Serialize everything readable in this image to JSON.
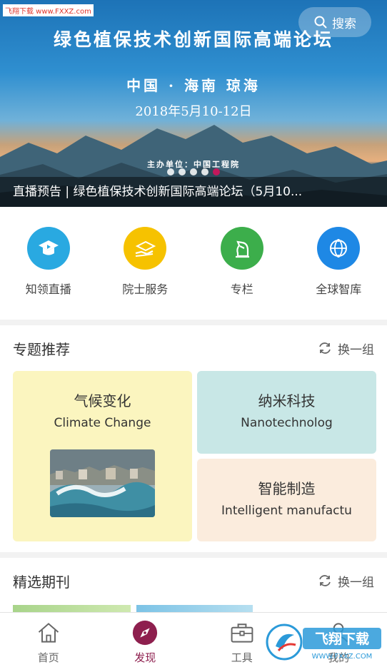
{
  "banner": {
    "watermark": "飞翔下载 www.FXXZ.com",
    "search_label": "搜索",
    "title": "绿色植保技术创新国际高端论坛",
    "location": "中国 · 海南 琼海",
    "date": "2018年5月10-12日",
    "host": "主办单位：中国工程院",
    "caption": "直播预告 | 绿色植保技术创新国际高端论坛（5月10...",
    "dots": 5,
    "active_dot": 4,
    "accent": "#c2185b"
  },
  "quicknav": {
    "items": [
      {
        "label": "知领直播",
        "icon": "graduation-play-icon",
        "color": "#29a9e1"
      },
      {
        "label": "院士服务",
        "icon": "hand-service-icon",
        "color": "#f6c200"
      },
      {
        "label": "专栏",
        "icon": "chess-knight-icon",
        "color": "#3cae4b"
      },
      {
        "label": "全球智库",
        "icon": "globe-network-icon",
        "color": "#1e88e5"
      }
    ]
  },
  "topics": {
    "title": "专题推荐",
    "refresh_label": "换一组",
    "cards": [
      {
        "cn": "气候变化",
        "en": "Climate Change",
        "bg": "#fbf5bf"
      },
      {
        "cn": "纳米科技",
        "en": "Nanotechnolog",
        "bg": "#c8e7e6"
      },
      {
        "cn": "智能制造",
        "en": "Intelligent manufactu",
        "bg": "#fbecdd"
      }
    ]
  },
  "journals": {
    "title": "精选期刊",
    "refresh_label": "换一组"
  },
  "bottomnav": {
    "items": [
      {
        "label": "首页",
        "icon": "home-icon"
      },
      {
        "label": "发现",
        "icon": "compass-icon"
      },
      {
        "label": "工具",
        "icon": "toolbox-icon"
      },
      {
        "label": "我的",
        "icon": "user-icon"
      }
    ],
    "active_index": 1,
    "active_color": "#8e1f4e"
  },
  "corner_watermark": {
    "text": "飞翔下载",
    "url": "WWW.FXXZ.COM"
  }
}
